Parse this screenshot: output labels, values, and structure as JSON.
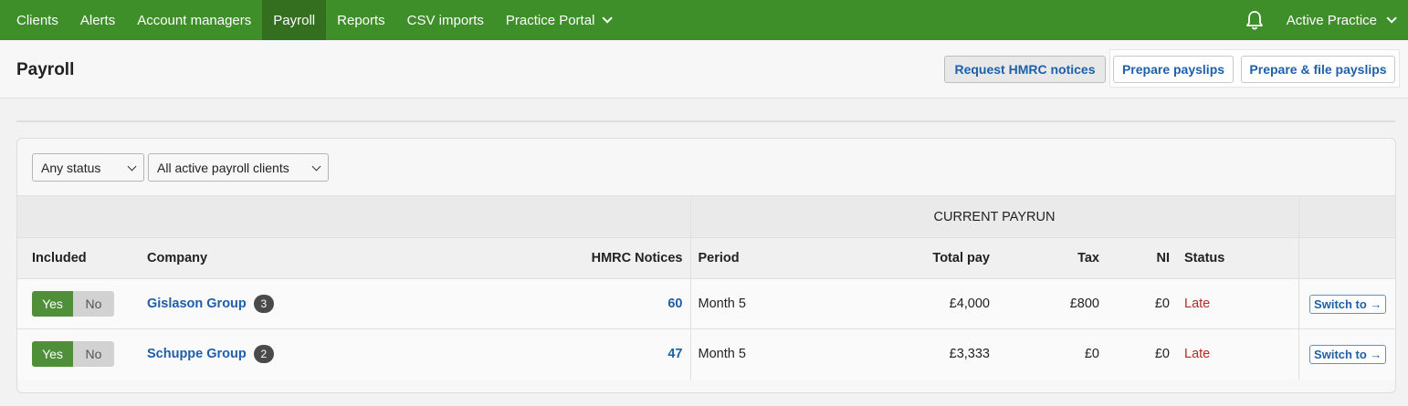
{
  "nav": {
    "items": [
      {
        "label": "Clients",
        "active": false
      },
      {
        "label": "Alerts",
        "active": false
      },
      {
        "label": "Account managers",
        "active": false
      },
      {
        "label": "Payroll",
        "active": true
      },
      {
        "label": "Reports",
        "active": false
      },
      {
        "label": "CSV imports",
        "active": false
      },
      {
        "label": "Practice Portal",
        "active": false
      }
    ],
    "practice_label": "Active Practice",
    "bell_icon": "bell-icon"
  },
  "header": {
    "title": "Payroll",
    "request_hmrc_label": "Request HMRC notices",
    "prepare_label": "Prepare payslips",
    "prepare_file_label": "Prepare & file payslips"
  },
  "filters": {
    "status": "Any status",
    "clients": "All active payroll clients"
  },
  "table": {
    "group_header": "CURRENT PAYRUN",
    "columns": {
      "included": "Included",
      "company": "Company",
      "hmrc": "HMRC Notices",
      "period": "Period",
      "total_pay": "Total pay",
      "tax": "Tax",
      "ni": "NI",
      "status": "Status"
    },
    "yes_label": "Yes",
    "no_label": "No",
    "switch_label": "Switch to →",
    "rows": [
      {
        "company": "Gislason Group",
        "badge": "3",
        "hmrc": "60",
        "period": "Month 5",
        "total_pay": "£4,000",
        "tax": "£800",
        "ni": "£0",
        "status": "Late"
      },
      {
        "company": "Schuppe Group",
        "badge": "2",
        "hmrc": "47",
        "period": "Month 5",
        "total_pay": "£3,333",
        "tax": "£0",
        "ni": "£0",
        "status": "Late"
      }
    ]
  },
  "colors": {
    "nav_green": "#3e8e2a",
    "link_blue": "#1f5fa8",
    "late_red": "#b52b27"
  }
}
